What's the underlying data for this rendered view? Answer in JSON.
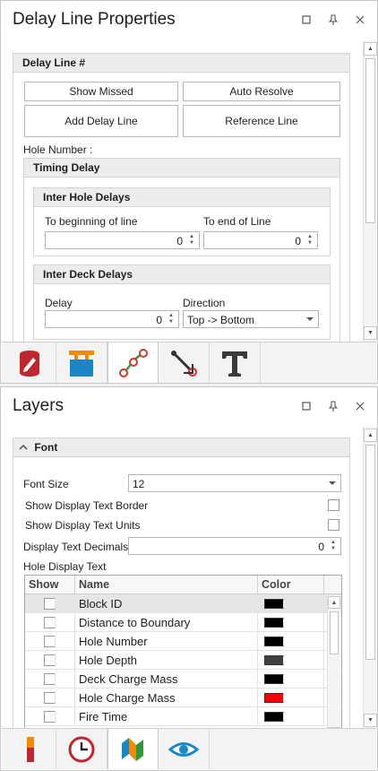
{
  "delay_panel": {
    "title": "Delay Line Properties",
    "section_title": "Delay Line #",
    "buttons": {
      "show_missed": "Show Missed",
      "auto_resolve": "Auto Resolve",
      "add_delay_line": "Add Delay Line",
      "reference_line": "Reference Line"
    },
    "hole_number_label": "Hole Number :",
    "timing_delay": {
      "title": "Timing Delay",
      "inter_hole": {
        "title": "Inter Hole Delays",
        "to_beginning_label": "To beginning of line",
        "to_beginning_value": "0",
        "to_end_label": "To end of Line",
        "to_end_value": "0"
      },
      "inter_deck": {
        "title": "Inter Deck Delays",
        "delay_label": "Delay",
        "delay_value": "0",
        "direction_label": "Direction",
        "direction_value": "Top -> Bottom"
      }
    },
    "tabs": [
      "database-pencil-icon",
      "detonator-icon",
      "delay-line-icon",
      "tie-up-icon",
      "text-icon"
    ]
  },
  "layers_panel": {
    "title": "Layers",
    "font_section": {
      "title": "Font",
      "font_size_label": "Font Size",
      "font_size_value": "12",
      "show_border_label": "Show Display Text Border",
      "show_units_label": "Show Display Text Units",
      "decimals_label": "Display Text Decimals",
      "decimals_value": "0",
      "hole_display_text_label": "Hole Display Text"
    },
    "grid": {
      "columns": [
        "Show",
        "Name",
        "Color"
      ],
      "rows": [
        {
          "name": "Block ID",
          "color": "#000000",
          "selected": true
        },
        {
          "name": "Distance to Boundary",
          "color": "#000000"
        },
        {
          "name": "Hole Number",
          "color": "#000000"
        },
        {
          "name": "Hole Depth",
          "color": "#404040"
        },
        {
          "name": "Deck Charge Mass",
          "color": "#000000"
        },
        {
          "name": "Hole Charge Mass",
          "color": "#ff0000"
        },
        {
          "name": "Fire Time",
          "color": "#000000"
        }
      ]
    },
    "tabs": [
      "legend-bar-icon",
      "clock-icon",
      "layers-map-icon",
      "eye-icon"
    ]
  }
}
